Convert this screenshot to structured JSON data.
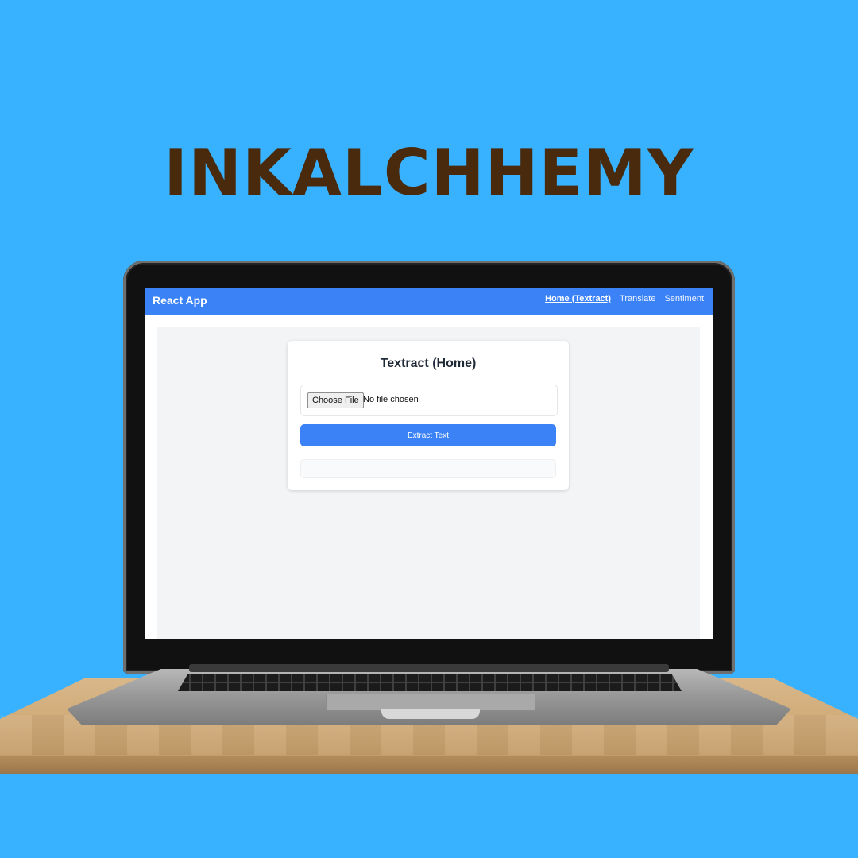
{
  "brand": {
    "text": "INKALCHHEMY"
  },
  "app": {
    "title": "React App",
    "nav": [
      {
        "label": "Home (Textract)",
        "active": true
      },
      {
        "label": "Translate",
        "active": false
      },
      {
        "label": "Sentiment",
        "active": false
      }
    ]
  },
  "card": {
    "title": "Textract (Home)",
    "file_button_label": "Choose File",
    "file_status": "No file chosen",
    "extract_button_label": "Extract Text",
    "result_text": ""
  },
  "colors": {
    "background": "#38b2ff",
    "brand_text": "#4a2a0c",
    "navbar": "#3b82f6",
    "primary_button": "#3b82f6",
    "content_bg": "#f3f4f6"
  }
}
